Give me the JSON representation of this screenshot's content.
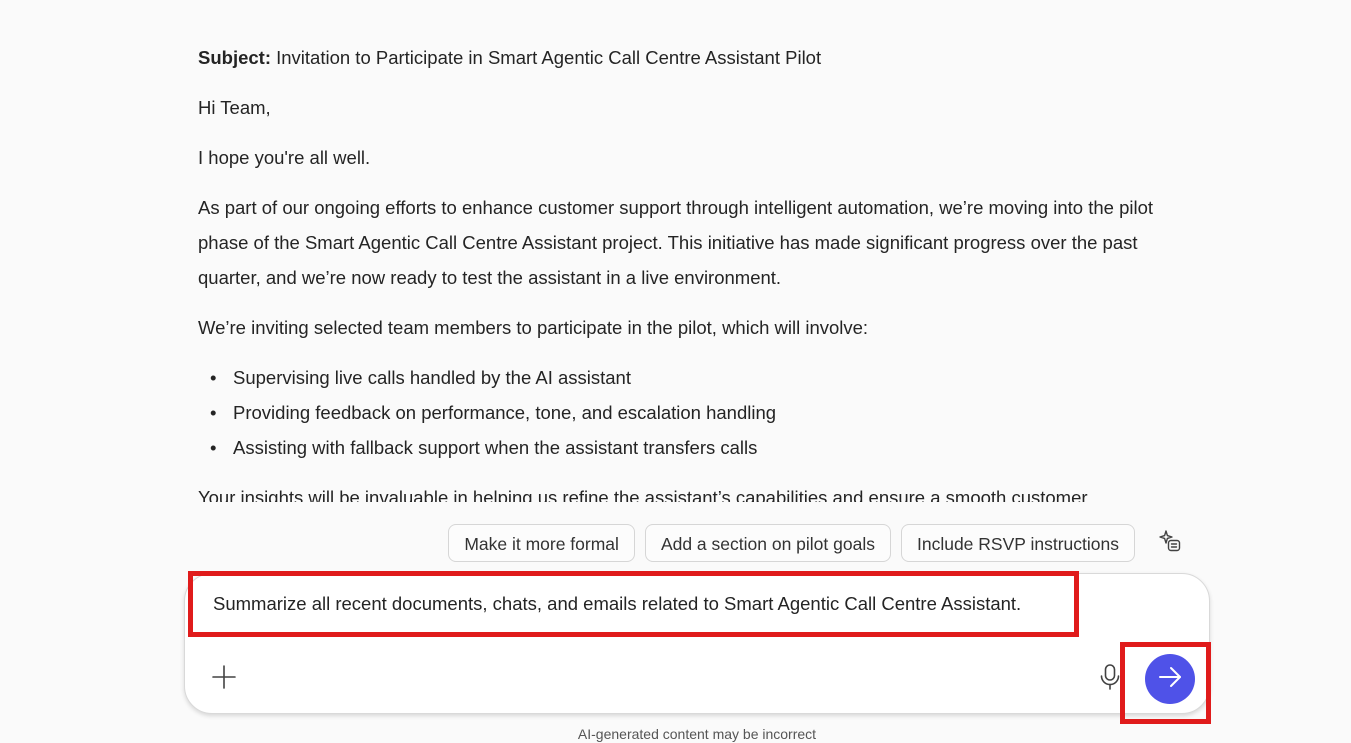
{
  "message": {
    "subject_label": "Subject:",
    "subject_text": " Invitation to Participate in Smart Agentic Call Centre Assistant Pilot",
    "greeting": "Hi Team,",
    "line1": "I hope you're all well.",
    "para1": "As part of our ongoing efforts to enhance customer support through intelligent automation, we’re moving into the pilot phase of the Smart Agentic Call Centre Assistant project. This initiative has made significant progress over the past quarter, and we’re now ready to test the assistant in a live environment.",
    "para2": "We’re inviting selected team members to participate in the pilot, which will involve:",
    "bullets": [
      "Supervising live calls handled by the AI assistant",
      "Providing feedback on performance, tone, and escalation handling",
      "Assisting with fallback support when the assistant transfers calls"
    ],
    "para3": "Your insights will be invaluable in helping us refine the assistant’s capabilities and ensure a smooth customer"
  },
  "suggestions": [
    "Make it more formal",
    "Add a section on pilot goals",
    "Include RSVP instructions"
  ],
  "composer": {
    "prompt": "Summarize all recent documents, chats, and emails related to Smart Agentic Call Centre Assistant."
  },
  "icons": {
    "sparkle": "sparkle-list-icon",
    "add": "plus-icon",
    "mic": "microphone-icon",
    "send": "arrow-right-icon"
  },
  "colors": {
    "send_button": "#4f52e8",
    "highlight_border": "#e01b1b"
  },
  "disclaimer": "AI-generated content may be incorrect"
}
